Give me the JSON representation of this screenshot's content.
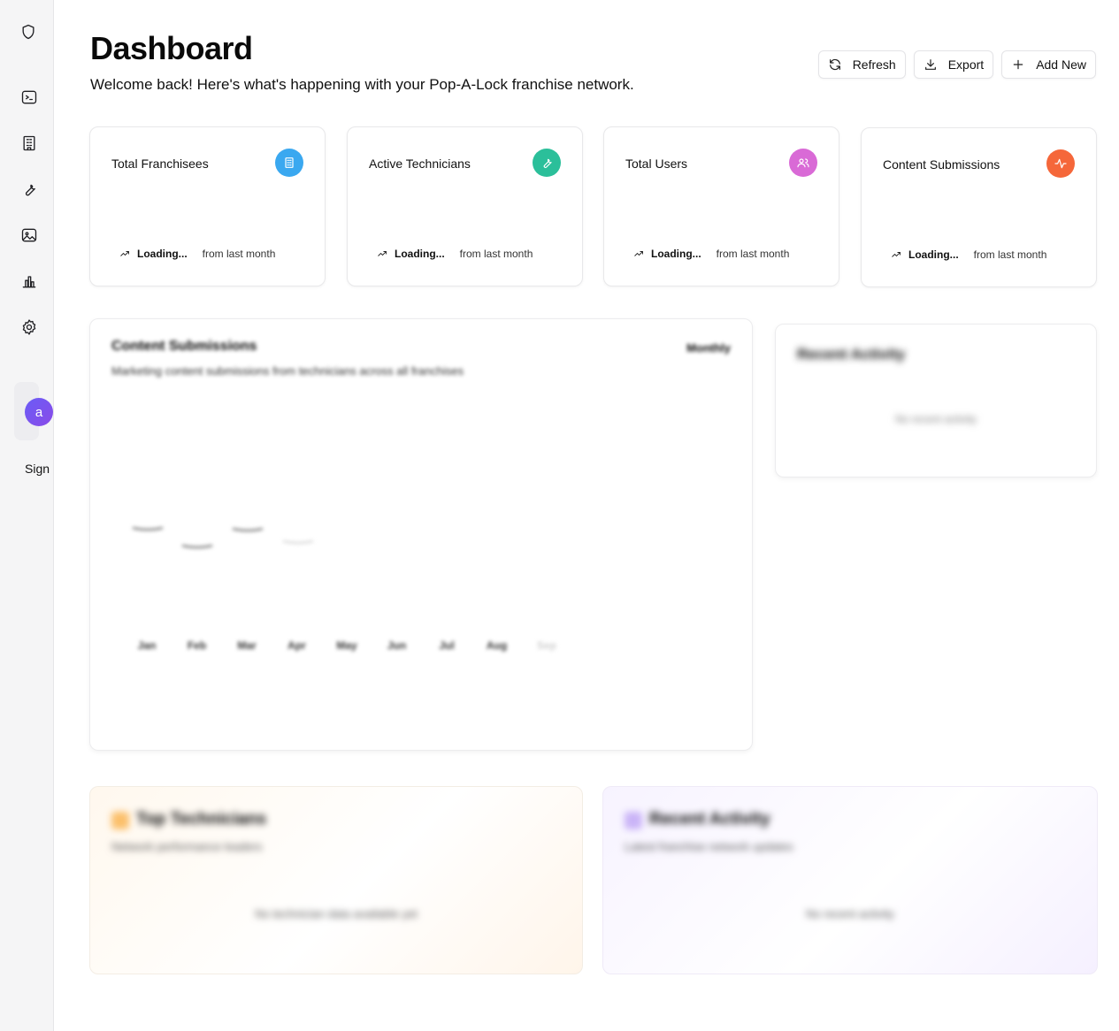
{
  "header": {
    "title": "Dashboard",
    "subtitle": "Welcome back! Here's what's happening with your Pop-A-Lock franchise network.",
    "actions": {
      "refresh": "Refresh",
      "export": "Export",
      "add_new": "Add New"
    }
  },
  "sidebar": {
    "avatar_letter": "a",
    "sign_label": "Sign",
    "items": [
      "shield-icon",
      "terminal-icon",
      "building-icon",
      "wrench-icon",
      "image-icon",
      "bar-chart-icon",
      "gear-icon"
    ]
  },
  "stats": [
    {
      "title": "Total Franchisees",
      "value": "Loading...",
      "period": "from last month",
      "icon": "building-icon",
      "color": "#3aa8f0"
    },
    {
      "title": "Active Technicians",
      "value": "Loading...",
      "period": "from last month",
      "icon": "wrench-icon",
      "color": "#2bbf9a"
    },
    {
      "title": "Total Users",
      "value": "Loading...",
      "period": "from last month",
      "icon": "users-icon",
      "color": "#d96ad6"
    },
    {
      "title": "Content Submissions",
      "value": "Loading...",
      "period": "from last month",
      "icon": "activity-icon",
      "color": "#f5673a"
    }
  ],
  "content_chart": {
    "title": "Content Submissions",
    "subtitle": "Marketing content submissions from technicians across all franchises",
    "period": "Monthly"
  },
  "chart_data": {
    "type": "line",
    "categories": [
      "Jan",
      "Feb",
      "Mar",
      "Apr",
      "May",
      "Jun",
      "Jul",
      "Aug",
      "Sep"
    ],
    "title": "Content Submissions",
    "xlabel": "",
    "ylabel": "",
    "grid": false
  },
  "recent_activity_side": {
    "title": "Recent Activity",
    "empty": "No recent activity"
  },
  "top_technicians": {
    "title": "Top Technicians",
    "subtitle": "Network performance leaders",
    "empty": "No technician data available yet"
  },
  "recent_activity_bottom": {
    "title": "Recent Activity",
    "subtitle": "Latest franchise network updates",
    "empty": "No recent activity"
  }
}
